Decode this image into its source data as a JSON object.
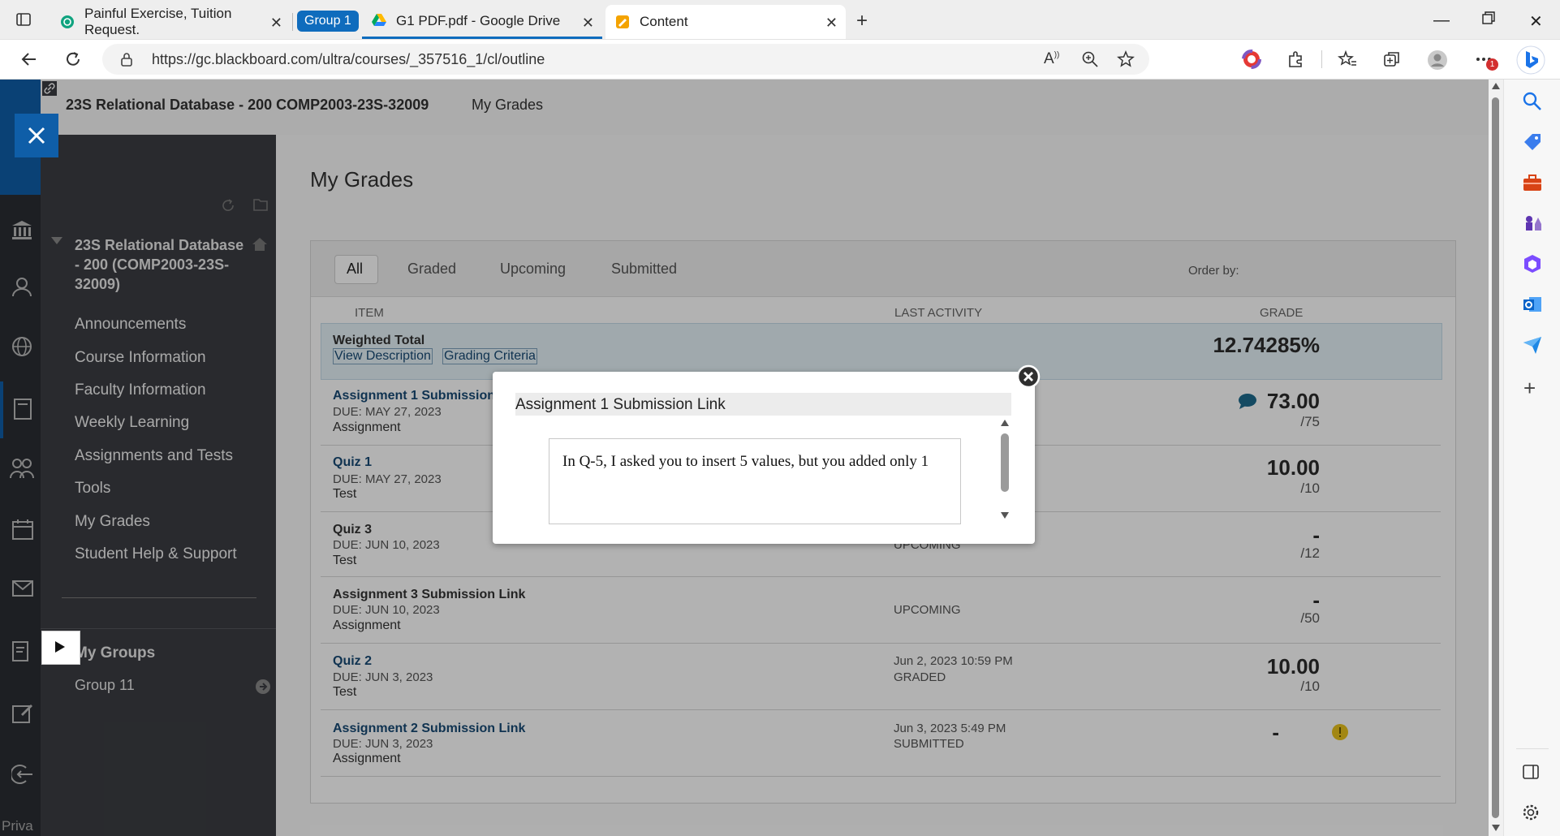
{
  "browser": {
    "tabs": [
      {
        "label": "Painful Exercise, Tuition Request."
      },
      {
        "label": "G1 PDF.pdf - Google Drive",
        "group_label": "Group 1"
      },
      {
        "label": "Content"
      }
    ],
    "url": "https://gc.blackboard.com/ultra/courses/_357516_1/cl/outline",
    "notification_badge": "1"
  },
  "header": {
    "course_title": "23S Relational Database - 200 COMP2003-23S-32009",
    "link_my_grades": "My Grades"
  },
  "course_menu": {
    "course_name": "23S Relational Database - 200 (COMP2003-23S-32009)",
    "items": [
      {
        "label": "Announcements"
      },
      {
        "label": "Course Information"
      },
      {
        "label": "Faculty Information"
      },
      {
        "label": "Weekly Learning"
      },
      {
        "label": "Assignments and Tests"
      },
      {
        "label": "Tools"
      },
      {
        "label": "My Grades"
      },
      {
        "label": "Student Help & Support"
      }
    ],
    "groups_heading": "My Groups",
    "group_item": "Group 11"
  },
  "left_rail": {
    "bottom_text": "Priva"
  },
  "grades": {
    "page_title": "My Grades",
    "filters": [
      "All",
      "Graded",
      "Upcoming",
      "Submitted"
    ],
    "active_filter": "All",
    "order_by": "Order by:",
    "columns": {
      "item": "ITEM",
      "last_activity": "LAST ACTIVITY",
      "grade": "GRADE"
    },
    "weighted_total": {
      "title": "Weighted Total",
      "link_description": "View Description",
      "link_criteria": "Grading Criteria",
      "value": "12.74285%"
    },
    "rows": [
      {
        "title": "Assignment 1 Submission",
        "due": "DUE: MAY 27, 2023",
        "type": "Assignment",
        "activity_date": "",
        "activity_status": "",
        "grade": "73.00",
        "out_of": "/75",
        "has_comment": true
      },
      {
        "title": "Quiz 1",
        "due": "DUE: MAY 27, 2023",
        "type": "Test",
        "activity_date": "",
        "activity_status": "",
        "grade": "10.00",
        "out_of": "/10"
      },
      {
        "title": "Quiz 3",
        "due": "DUE: JUN 10, 2023",
        "type": "Test",
        "activity_date": "",
        "activity_status": "UPCOMING",
        "grade": "-",
        "out_of": "/12"
      },
      {
        "title": "Assignment 3 Submission Link",
        "due": "DUE: JUN 10, 2023",
        "type": "Assignment",
        "activity_date": "",
        "activity_status": "UPCOMING",
        "grade": "-",
        "out_of": "/50"
      },
      {
        "title": "Quiz 2",
        "due": "DUE: JUN 3, 2023",
        "type": "Test",
        "activity_date": "Jun 2, 2023 10:59 PM",
        "activity_status": "GRADED",
        "grade": "10.00",
        "out_of": "/10"
      },
      {
        "title": "Assignment 2 Submission Link",
        "due": "DUE: JUN 3, 2023",
        "type": "Assignment",
        "activity_date": "Jun 3, 2023 5:49 PM",
        "activity_status": "SUBMITTED",
        "grade": "-",
        "out_of": ""
      }
    ]
  },
  "modal": {
    "title": "Assignment 1 Submission Link",
    "comment": "In Q-5, I asked you to insert 5 values, but you added only 1"
  },
  "colors": {
    "accent": "#0f5ea8",
    "link": "#174a74",
    "course_menu_bg": "#3b3d42"
  }
}
